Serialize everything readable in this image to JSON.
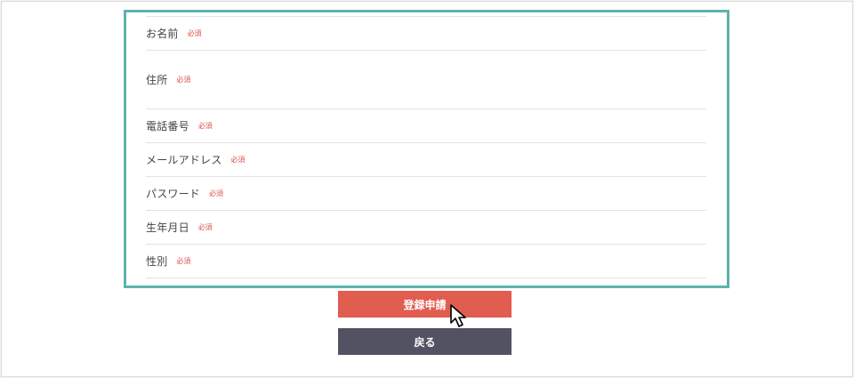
{
  "form": {
    "rows": [
      {
        "label": "お名前",
        "required": "必須"
      },
      {
        "label": "住所",
        "required": "必須"
      },
      {
        "label": "電話番号",
        "required": "必須"
      },
      {
        "label": "メールアドレス",
        "required": "必須"
      },
      {
        "label": "パスワード",
        "required": "必須"
      },
      {
        "label": "生年月日",
        "required": "必須"
      },
      {
        "label": "性別",
        "required": "必須"
      }
    ]
  },
  "actions": {
    "submit_label": "登録申請",
    "back_label": "戻る"
  },
  "icons": {
    "cursor": "mouse-pointer-icon"
  },
  "colors": {
    "panel_border": "#5fb2ad",
    "required_text": "#d9534f",
    "submit_button": "#e05d4f",
    "back_button": "#535263"
  }
}
